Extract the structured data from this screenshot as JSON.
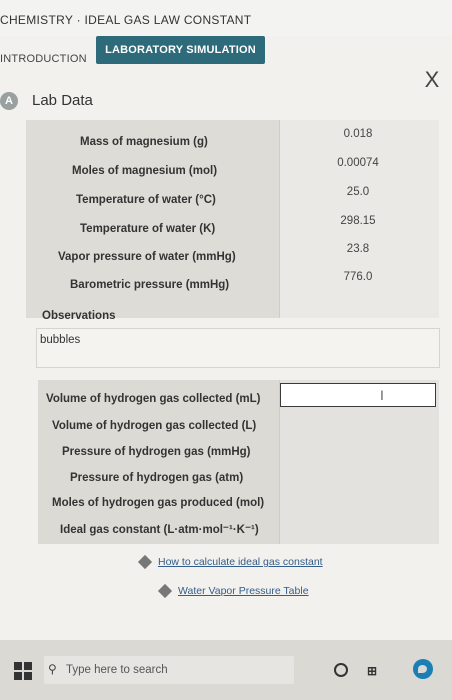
{
  "app": {
    "title": "CHEMISTRY · IDEAL GAS LAW CONSTANT"
  },
  "tabs": {
    "introduction": "INTRODUCTION",
    "laboratory": "LABORATORY SIMULATION"
  },
  "close_label": "X",
  "section": {
    "badge": "A",
    "title": "Lab Data"
  },
  "lab_data": [
    {
      "label": "Mass of magnesium (g)",
      "value": "0.018"
    },
    {
      "label": "Moles of magnesium (mol)",
      "value": "0.00074"
    },
    {
      "label": "Temperature of water (°C)",
      "value": "25.0"
    },
    {
      "label": "Temperature of water (K)",
      "value": "298.15"
    },
    {
      "label": "Vapor pressure of water (mmHg)",
      "value": "23.8"
    },
    {
      "label": "Barometric pressure (mmHg)",
      "value": "776.0"
    }
  ],
  "observations": {
    "label": "Observations",
    "text": "bubbles"
  },
  "calculations": [
    {
      "label": "Volume of hydrogen gas collected (mL)",
      "value": ""
    },
    {
      "label": "Volume of hydrogen gas collected (L)",
      "value": ""
    },
    {
      "label": "Pressure of hydrogen gas (mmHg)",
      "value": ""
    },
    {
      "label": "Pressure of hydrogen gas (atm)",
      "value": ""
    },
    {
      "label": "Moles of hydrogen gas produced (mol)",
      "value": ""
    },
    {
      "label": "Ideal gas constant (L·atm·mol⁻¹·K⁻¹)",
      "value": ""
    }
  ],
  "links": {
    "ideal_gas": "How to calculate ideal gas constant",
    "vapor_table": "Water Vapor Pressure Table"
  },
  "taskbar": {
    "search_placeholder": "Type here to search"
  }
}
